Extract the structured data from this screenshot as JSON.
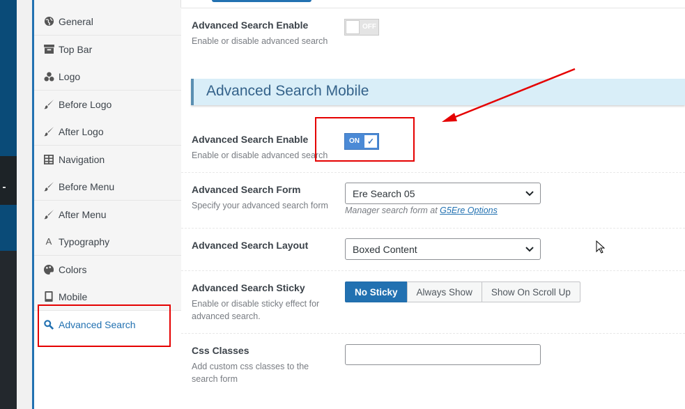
{
  "sidebar": {
    "items": [
      {
        "label": "General",
        "icon": "globe-icon"
      },
      {
        "label": "Top Bar",
        "icon": "archive-icon"
      },
      {
        "label": "Logo",
        "icon": "groups-icon"
      },
      {
        "label": "Before Logo",
        "icon": "brush-icon"
      },
      {
        "label": "After Logo",
        "icon": "brush-icon"
      },
      {
        "label": "Navigation",
        "icon": "table-icon"
      },
      {
        "label": "Before Menu",
        "icon": "brush-icon"
      },
      {
        "label": "After Menu",
        "icon": "brush-icon"
      },
      {
        "label": "Typography",
        "icon": "text-icon"
      },
      {
        "label": "Colors",
        "icon": "palette-icon"
      },
      {
        "label": "Mobile",
        "icon": "mobile-icon"
      },
      {
        "label": "Advanced Search",
        "icon": "search-icon",
        "active": true
      }
    ]
  },
  "main": {
    "desktop_enable": {
      "title": "Advanced Search Enable",
      "desc": "Enable or disable advanced search",
      "toggle_label": "OFF"
    },
    "section_title": "Advanced Search Mobile",
    "mobile_enable": {
      "title": "Advanced Search Enable",
      "desc": "Enable or disable advanced search",
      "toggle_label": "ON"
    },
    "search_form": {
      "title": "Advanced Search Form",
      "desc": "Specify your advanced search form",
      "value": "Ere Search 05",
      "hint_prefix": "Manager search form at ",
      "hint_link": "G5Ere Options"
    },
    "search_layout": {
      "title": "Advanced Search Layout",
      "value": "Boxed Content"
    },
    "search_sticky": {
      "title": "Advanced Search Sticky",
      "desc_line1": "Enable or disable sticky effect for",
      "desc_line2": "advanced search.",
      "options": [
        "No Sticky",
        "Always Show",
        "Show On Scroll Up"
      ],
      "selected": "No Sticky"
    },
    "css_classes": {
      "title": "Css Classes",
      "desc_line1": "Add custom css classes to the",
      "desc_line2": "search form",
      "value": ""
    }
  },
  "colors": {
    "accent": "#2271b1",
    "annotation": "#e50000",
    "section_bg": "#d9eef8"
  }
}
